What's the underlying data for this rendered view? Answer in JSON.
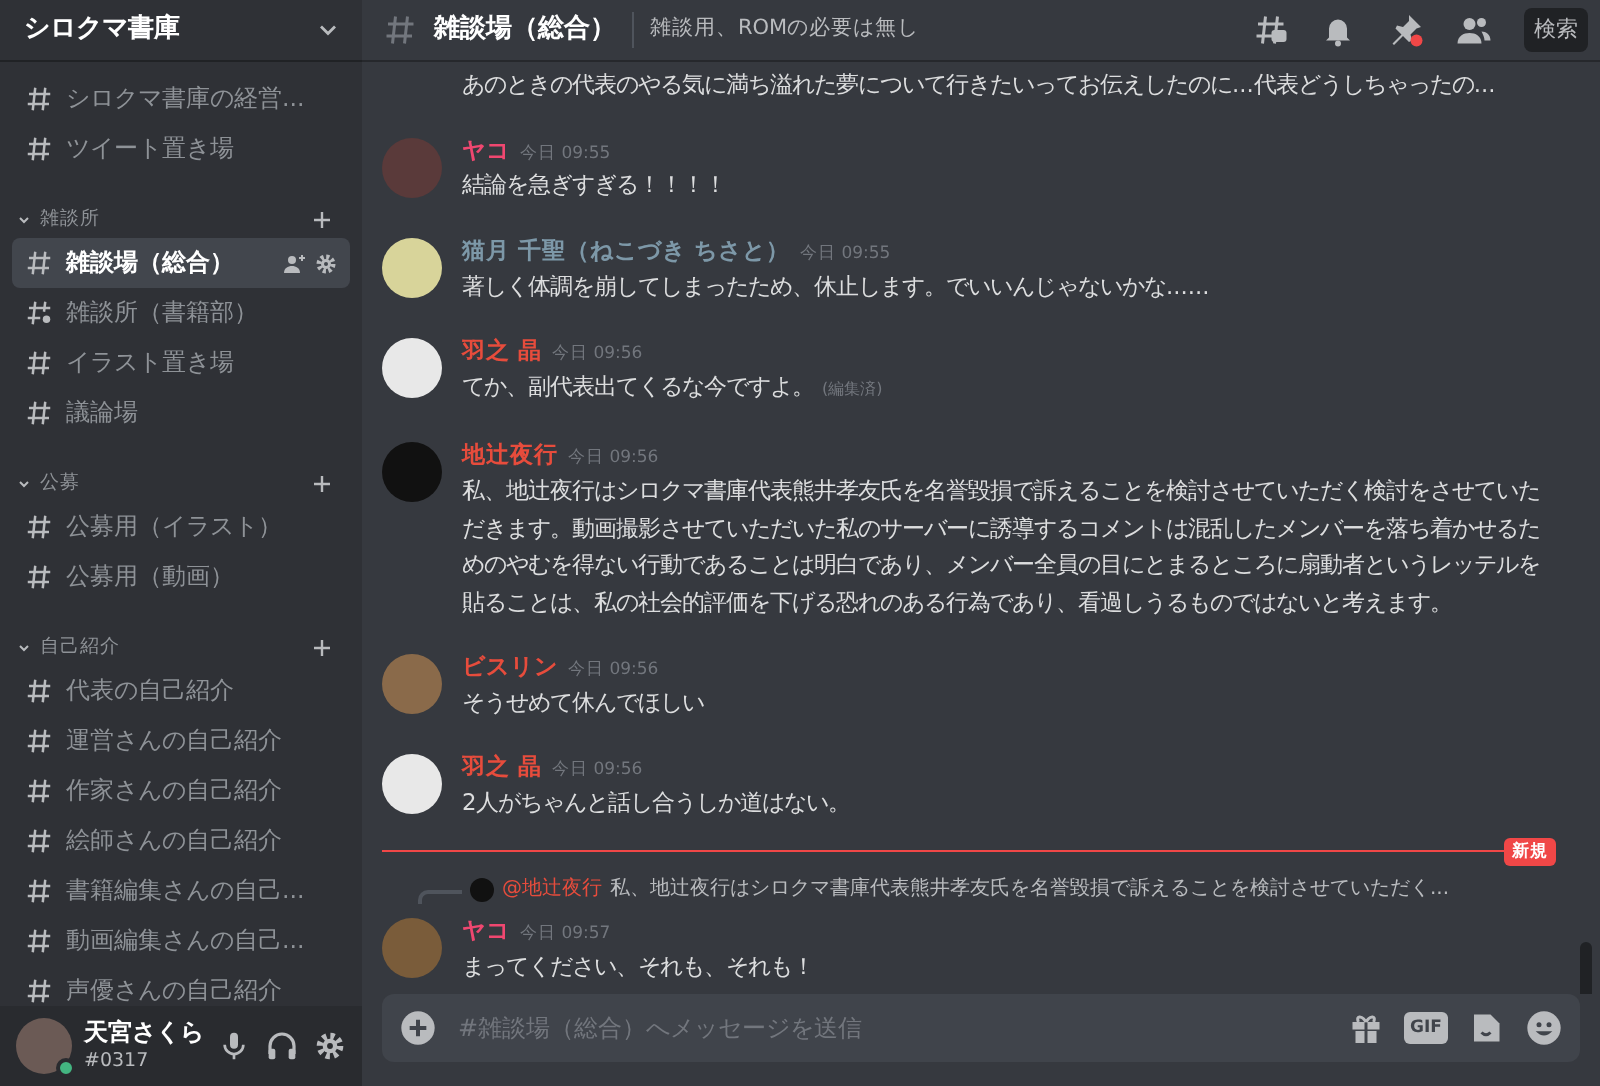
{
  "server": {
    "name": "シロクマ書庫"
  },
  "channel_groups": [
    {
      "channels": [
        {
          "name": "シロクマ書庫の経営...",
          "kind": "text",
          "selected": false
        },
        {
          "name": "ツイート置き場",
          "kind": "text",
          "selected": false
        }
      ]
    },
    {
      "category": "雑談所",
      "channels": [
        {
          "name": "雑談場（総合）",
          "kind": "text",
          "selected": true
        },
        {
          "name": "雑談所（書籍部）",
          "kind": "thread",
          "selected": false
        },
        {
          "name": "イラスト置き場",
          "kind": "text",
          "selected": false
        },
        {
          "name": "議論場",
          "kind": "text",
          "selected": false
        }
      ]
    },
    {
      "category": "公募",
      "channels": [
        {
          "name": "公募用（イラスト）",
          "kind": "text",
          "selected": false
        },
        {
          "name": "公募用（動画）",
          "kind": "text",
          "selected": false
        }
      ]
    },
    {
      "category": "自己紹介",
      "channels": [
        {
          "name": "代表の自己紹介",
          "kind": "text",
          "selected": false
        },
        {
          "name": "運営さんの自己紹介",
          "kind": "text",
          "selected": false
        },
        {
          "name": "作家さんの自己紹介",
          "kind": "text",
          "selected": false
        },
        {
          "name": "絵師さんの自己紹介",
          "kind": "text",
          "selected": false
        },
        {
          "name": "書籍編集さんの自己...",
          "kind": "text",
          "selected": false
        },
        {
          "name": "動画編集さんの自己...",
          "kind": "text",
          "selected": false
        },
        {
          "name": "声優さんの自己紹介",
          "kind": "text",
          "selected": false
        }
      ]
    }
  ],
  "user_panel": {
    "name": "天宮さくら",
    "tag": "#0317",
    "online": true
  },
  "header": {
    "channel": "雑談場（総合）",
    "topic": "雑談用、ROMの必要は無し",
    "search": "検索"
  },
  "messages": [
    {
      "text": "あのときの代表のやる気に満ち溢れた夢について行きたいってお伝えしたのに...代表どうしちゃったの...",
      "edited": false
    },
    {
      "author": "ヤコ",
      "color": "#f04770",
      "time": "今日 09:55",
      "text": "結論を急ぎすぎる！！！！",
      "edited": false
    },
    {
      "author": "猫月 千聖（ねこづき ちさと）",
      "color": "#7d98a8",
      "time": "今日 09:55",
      "text": "著しく体調を崩してしまったため、休止します。でいいんじゃないかな......",
      "edited": false
    },
    {
      "author": "羽之 晶",
      "color": "#e74c3c",
      "time": "今日 09:56",
      "text": "てか、副代表出てくるな今ですよ。",
      "edited": true,
      "edited_label": "(編集済)"
    },
    {
      "author": "地辻夜行",
      "color": "#e74c3c",
      "time": "今日 09:56",
      "text": "私、地辻夜行はシロクマ書庫代表熊井孝友氏を名誉毀損で訴えることを検討させていただく検討をさせていただきます。動画撮影させていただいた私のサーバーに誘導するコメントは混乱したメンバーを落ち着かせるためのやむを得ない行動であることは明白であり、メンバー全員の目にとまるところに扇動者というレッテルを貼ることは、私の社会的評価を下げる恐れのある行為であり、看過しうるものではないと考えます。",
      "edited": false
    },
    {
      "author": "ビスリン",
      "color": "#e74c3c",
      "time": "今日 09:56",
      "text": "そうせめて休んでほしい",
      "edited": false
    },
    {
      "author": "羽之 晶",
      "color": "#e74c3c",
      "time": "今日 09:56",
      "text": "2人がちゃんと話し合うしか道はない。",
      "edited": false
    },
    {
      "kind": "divider",
      "label": "新規"
    },
    {
      "author": "ヤコ",
      "color": "#f04770",
      "time": "今日 09:57",
      "text": "まってください、それも、それも！",
      "edited": false,
      "reply": {
        "mention": "@地辻夜行",
        "text": "私、地辻夜行はシロクマ書庫代表熊井孝友氏を名誉毀損で訴えることを検討させていただく..."
      }
    }
  ],
  "composer": {
    "placeholder": "#雑談場（総合）へメッセージを送信",
    "gif_label": "GIF"
  }
}
